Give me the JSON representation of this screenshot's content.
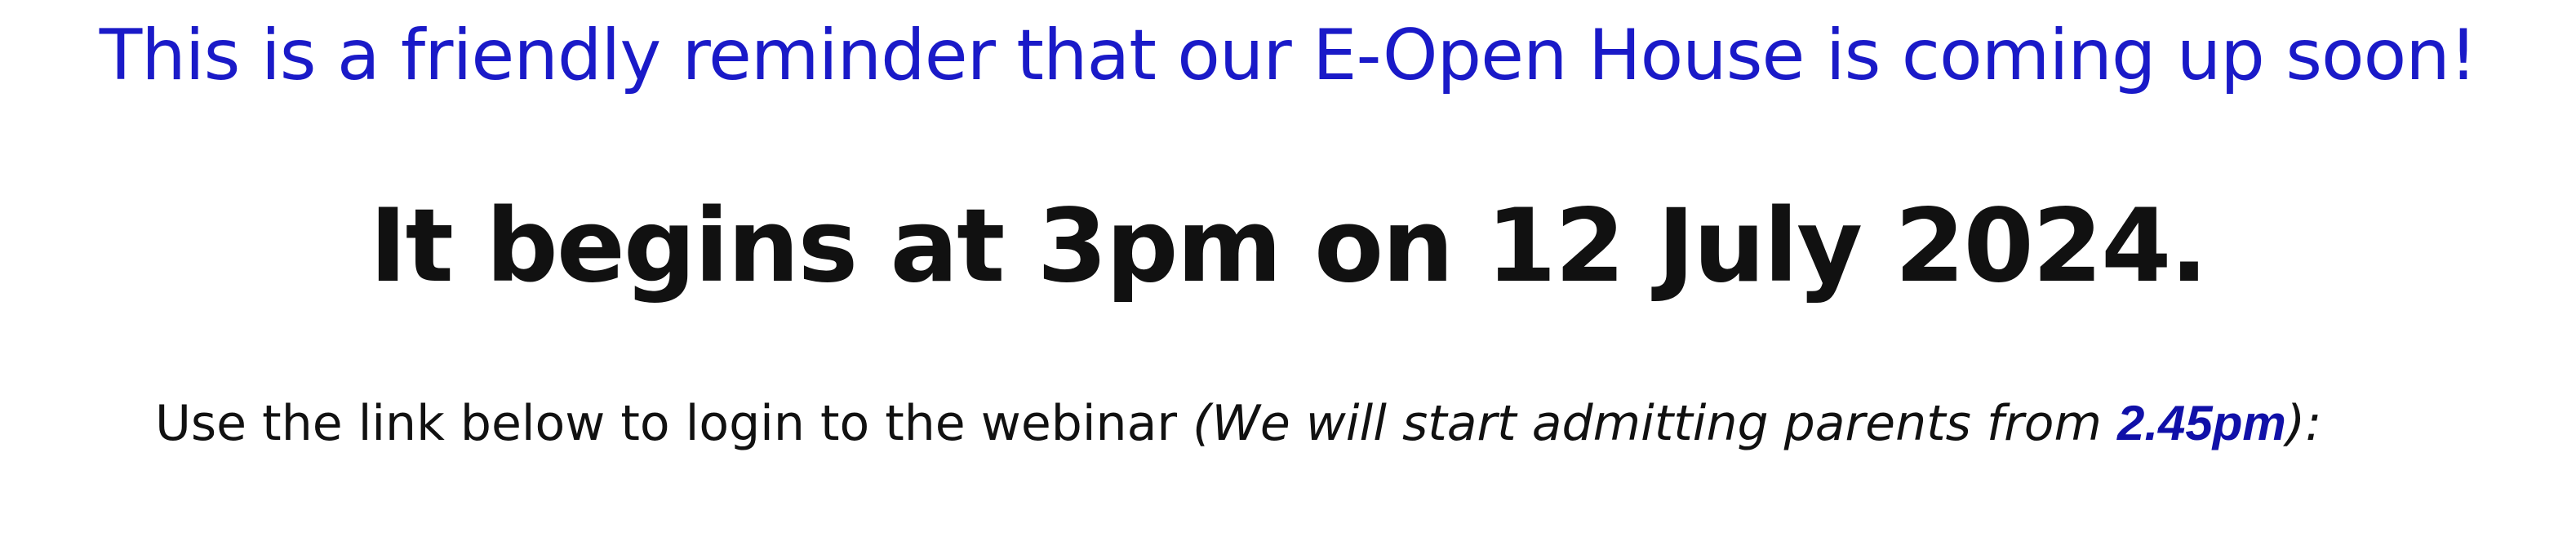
{
  "reminder_text": "This is a friendly reminder that our E-Open House is coming up soon!",
  "begins_text": "It begins at 3pm on 12 July 2024.",
  "instruction": {
    "lead": "Use the link below to login to the webinar ",
    "paren_open": "(We will start admitting parents from ",
    "time": "2.45pm",
    "paren_close": "):"
  },
  "colors": {
    "reminder": "#1a1ac8",
    "time_highlight": "#1010a8",
    "body_text": "#111111"
  }
}
